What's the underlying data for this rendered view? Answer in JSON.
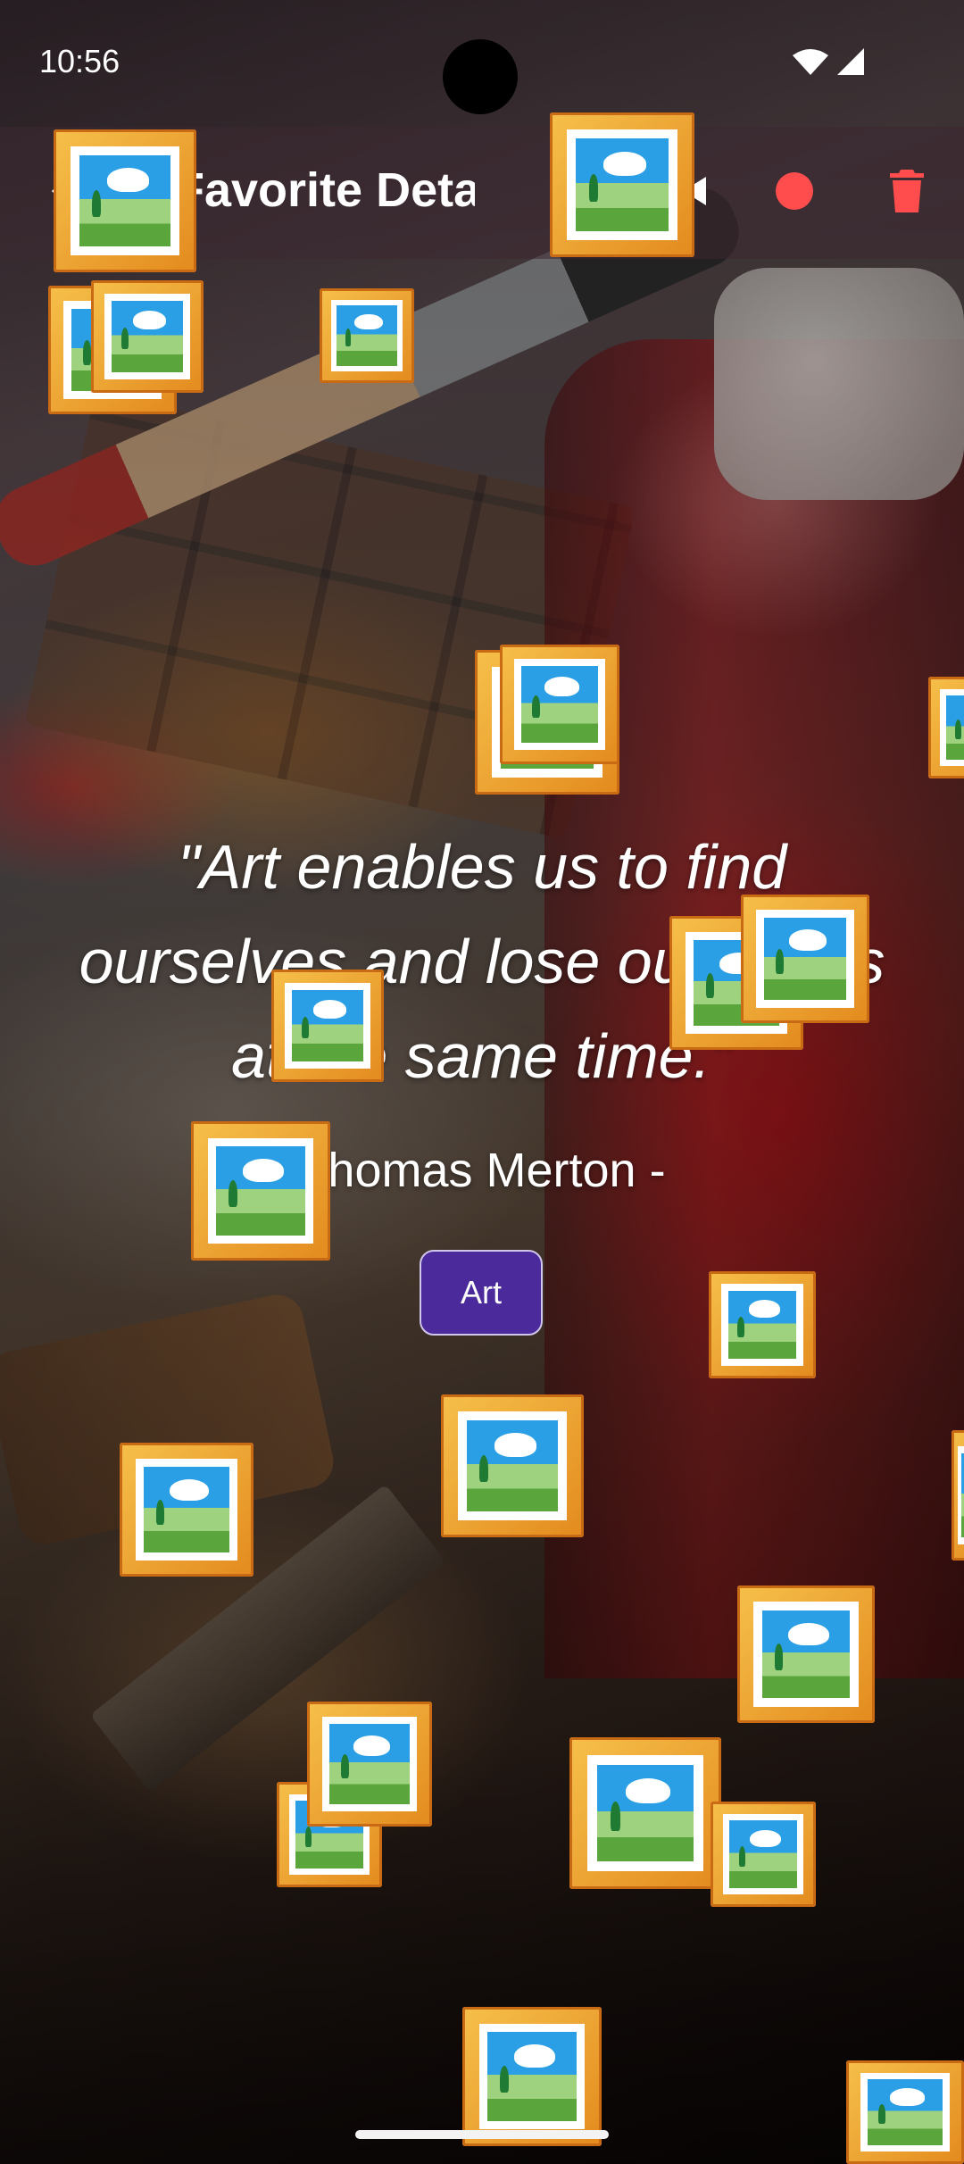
{
  "status_bar": {
    "time": "10:56"
  },
  "app_bar": {
    "title": "Favorite Details",
    "actions": [
      "share-icon",
      "videocam-icon",
      "record-icon",
      "delete-icon"
    ],
    "colors": {
      "record": "#ff4d4d",
      "delete": "#ff4d4d"
    }
  },
  "quote": {
    "text": "\"Art enables us to find ourselves and lose ourselves at the same time.\"",
    "author": "Thomas Merton -",
    "category": "Art"
  },
  "decorations": {
    "emoji": "framed-picture-icon"
  },
  "colors": {
    "tag_background": "#4b2a9b"
  }
}
